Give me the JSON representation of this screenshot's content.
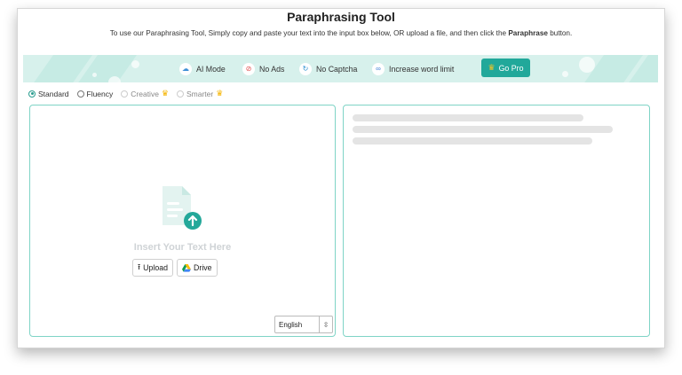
{
  "header": {
    "title": "Paraphrasing Tool",
    "subtitle_pre": "To use our Paraphrasing Tool, Simply copy and paste your text into the input box below, OR upload a file, and then click the ",
    "subtitle_bold": "Paraphrase",
    "subtitle_post": " button."
  },
  "banner": {
    "features": [
      {
        "label": "AI Mode",
        "icon": "ai-mode-icon"
      },
      {
        "label": "No Ads",
        "icon": "no-ads-icon"
      },
      {
        "label": "No Captcha",
        "icon": "captcha-icon"
      },
      {
        "label": "Increase word limit",
        "icon": "infinity-icon"
      }
    ],
    "go_pro_label": "Go Pro"
  },
  "modes": [
    {
      "label": "Standard",
      "selected": true,
      "premium": false
    },
    {
      "label": "Fluency",
      "selected": false,
      "premium": false
    },
    {
      "label": "Creative",
      "selected": false,
      "premium": true
    },
    {
      "label": "Smarter",
      "selected": false,
      "premium": true
    }
  ],
  "input_panel": {
    "placeholder": "Insert Your Text Here",
    "upload_label": "Upload",
    "drive_label": "Drive",
    "language": "English"
  },
  "colors": {
    "accent": "#21a89a",
    "banner_bg": "#d7f1ec",
    "panel_border": "#7fd4c6",
    "crown": "#f5b400"
  }
}
